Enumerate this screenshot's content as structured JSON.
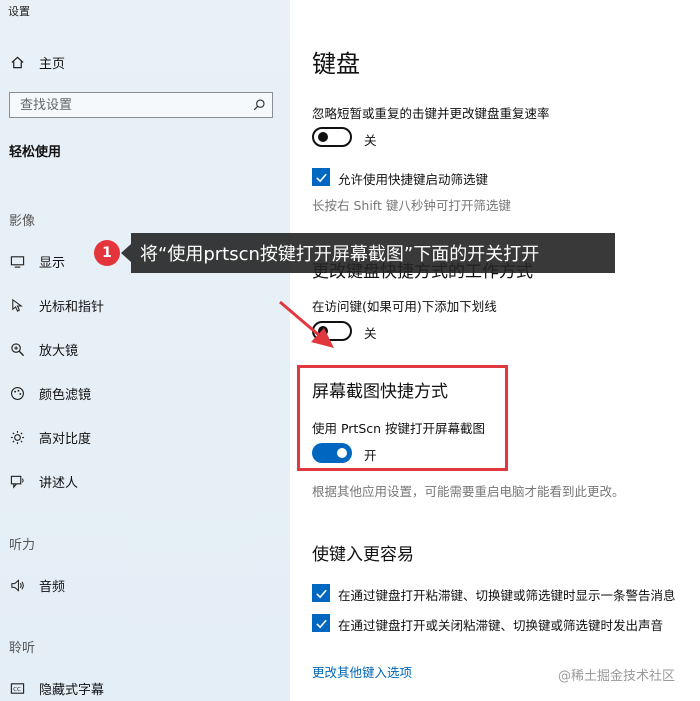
{
  "window": {
    "title": "设置"
  },
  "sidebar": {
    "home_label": "主页",
    "search_placeholder": "查找设置",
    "group_title": "轻松使用",
    "section_vision": "影像",
    "section_hearing": "听力",
    "section_hearing2": "聆听",
    "items": [
      {
        "label": "显示",
        "icon": "monitor-icon"
      },
      {
        "label": "光标和指针",
        "icon": "cursor-icon"
      },
      {
        "label": "放大镜",
        "icon": "magnifier-icon"
      },
      {
        "label": "颜色滤镜",
        "icon": "palette-icon"
      },
      {
        "label": "高对比度",
        "icon": "sun-icon"
      },
      {
        "label": "讲述人",
        "icon": "narrator-icon"
      },
      {
        "label": "音频",
        "icon": "speaker-icon"
      },
      {
        "label": "隐藏式字幕",
        "icon": "caption-icon"
      }
    ]
  },
  "main": {
    "title": "键盘",
    "filter_keys_label": "忽略短暂或重复的击键并更改键盘重复速率",
    "filter_keys_state": "关",
    "filter_shortcut_label": "允许使用快捷键启动筛选键",
    "filter_shortcut_hint": "长按右 Shift 键八秒钟可打开筛选键",
    "section_shortcut_title": "更改键盘快捷方式的工作方式",
    "underline_label": "在访问键(如果可用)下添加下划线",
    "underline_state": "关",
    "section_printscreen_title": "屏幕截图快捷方式",
    "printscreen_label": "使用 PrtScn 按键打开屏幕截图",
    "printscreen_state": "开",
    "printscreen_hint": "根据其他应用设置，可能需要重启电脑才能看到此更改。",
    "section_typing_title": "使键入更容易",
    "typing_warning_label": "在通过键盘打开粘滞键、切换键或筛选键时显示一条警告消息",
    "typing_sound_label": "在通过键盘打开或关闭粘滞键、切换键或筛选键时发出声音",
    "typing_more_link": "更改其他键入选项"
  },
  "overlay": {
    "step_number": "1",
    "instruction": "将“使用prtscn按键打开屏幕截图”下面的开关打开",
    "watermark": "@稀土掘金技术社区"
  },
  "colors": {
    "accent": "#0067c0",
    "highlight": "#e0383e",
    "badge": "#e5353c"
  }
}
